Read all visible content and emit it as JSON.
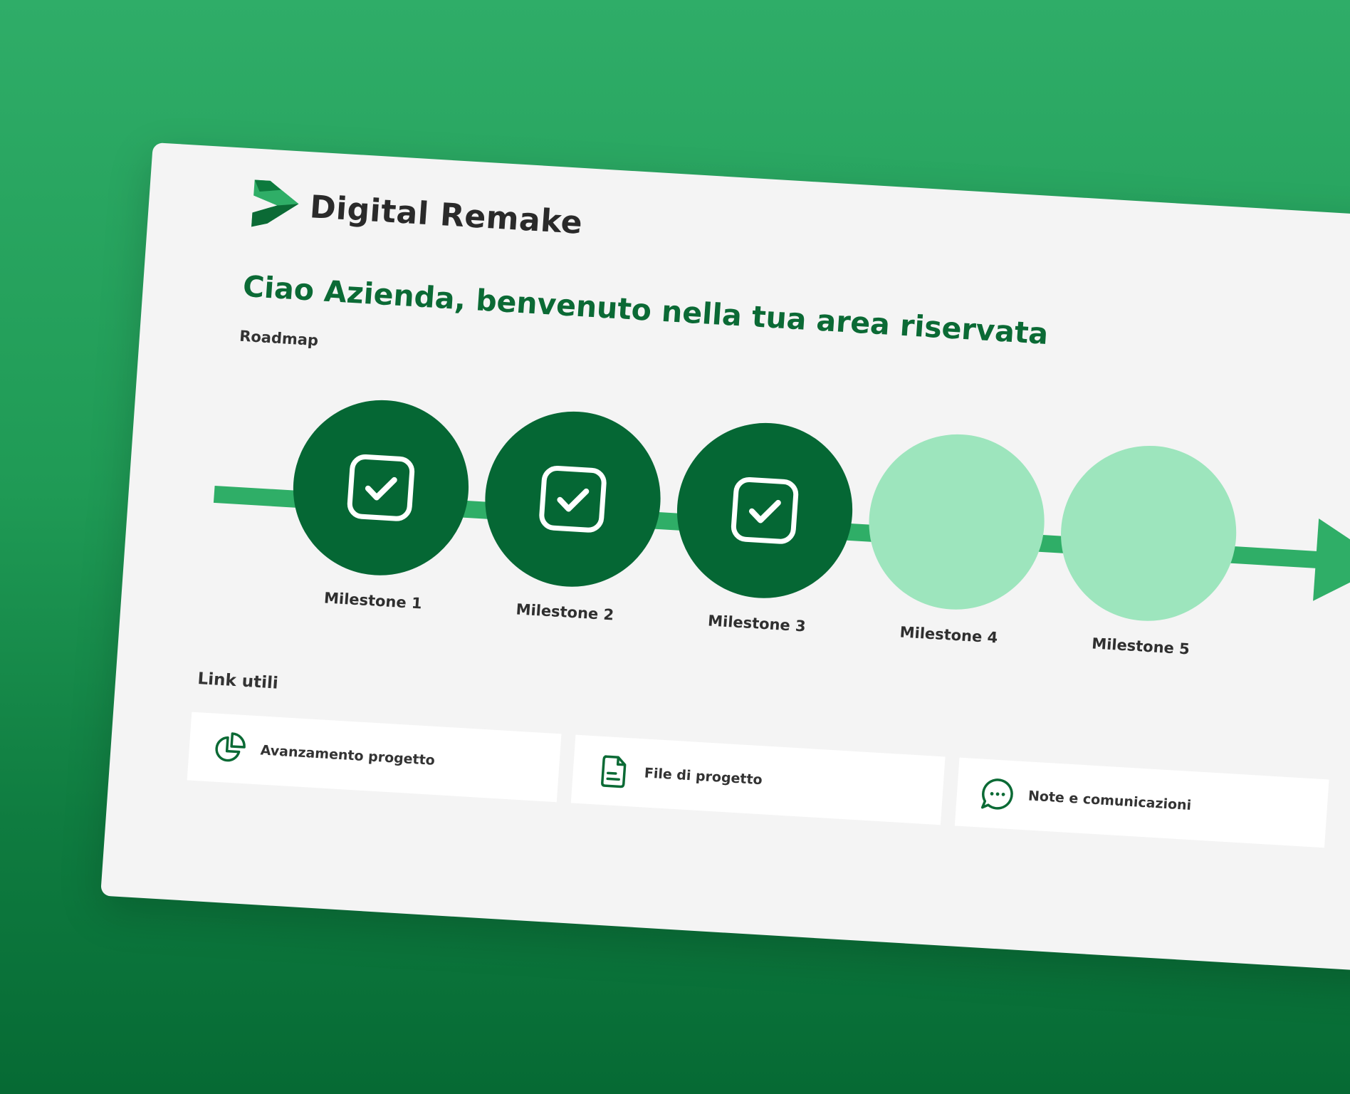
{
  "brand": {
    "name": "Digital Remake",
    "logo_icon": "play-arrow-logo-icon",
    "accent_dark": "#056734",
    "accent": "#2fae67",
    "accent_light": "#9de5bd"
  },
  "welcome": {
    "title": "Ciao Azienda, benvenuto nella tua area riservata"
  },
  "roadmap": {
    "label": "Roadmap",
    "milestones": [
      {
        "label": "Milestone 1",
        "status": "completed",
        "icon": "check-square-icon"
      },
      {
        "label": "Milestone 2",
        "status": "completed",
        "icon": "check-square-icon"
      },
      {
        "label": "Milestone 3",
        "status": "completed",
        "icon": "check-square-icon"
      },
      {
        "label": "Milestone 4",
        "status": "pending"
      },
      {
        "label": "Milestone 5",
        "status": "pending"
      }
    ]
  },
  "links": {
    "label": "Link utili",
    "items": [
      {
        "label": "Avanzamento progetto",
        "icon": "pie-chart-icon"
      },
      {
        "label": "File di progetto",
        "icon": "document-icon"
      },
      {
        "label": "Note e comunicazioni",
        "icon": "chat-bubble-icon"
      }
    ]
  }
}
